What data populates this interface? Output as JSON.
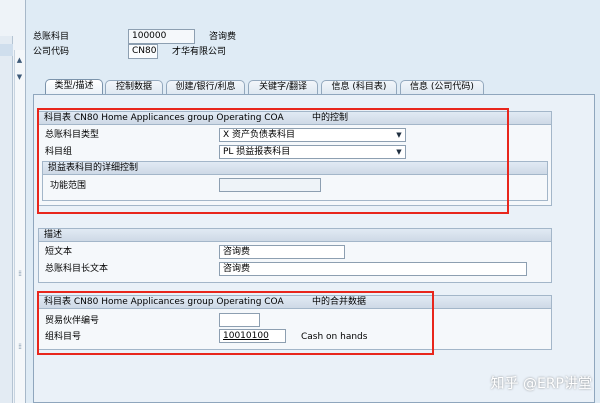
{
  "header": {
    "gl_account_label": "总账科目",
    "gl_account_value": "100000",
    "gl_account_desc": "咨询费",
    "company_code_label": "公司代码",
    "company_code_value": "CN80",
    "company_name": "才华有限公司"
  },
  "tabs": [
    {
      "label": "类型/描述",
      "active": true
    },
    {
      "label": "控制数据",
      "active": false
    },
    {
      "label": "创建/银行/利息",
      "active": false
    },
    {
      "label": "关键字/翻译",
      "active": false
    },
    {
      "label": "信息 (科目表)",
      "active": false
    },
    {
      "label": "信息 (公司代码)",
      "active": false
    }
  ],
  "control_group": {
    "title": "科目表 CN80 Home Applicances group Operating COA",
    "title_suffix": "中的控制",
    "account_type_label": "总账科目类型",
    "account_type_value": "X 资产负债表科目",
    "account_group_label": "科目组",
    "account_group_value": "PL 损益报表科目",
    "detail_title": "损益表科目的详细控制",
    "functional_area_label": "功能范围",
    "functional_area_value": ""
  },
  "description_group": {
    "title": "描述",
    "short_text_label": "短文本",
    "short_text_value": "咨询费",
    "long_text_label": "总账科目长文本",
    "long_text_value": "咨询费"
  },
  "consolidation_group": {
    "title": "科目表 CN80 Home Applicances group Operating COA",
    "title_suffix": "中的合并数据",
    "trading_partner_label": "贸易伙伴编号",
    "trading_partner_value": "",
    "group_account_label": "组科目号",
    "group_account_value": "10010100",
    "group_account_desc": "Cash on hands"
  },
  "watermark": "知乎 @ERP讲堂",
  "colors": {
    "highlight_border": "#e8261c",
    "background": "#dfebf5"
  }
}
